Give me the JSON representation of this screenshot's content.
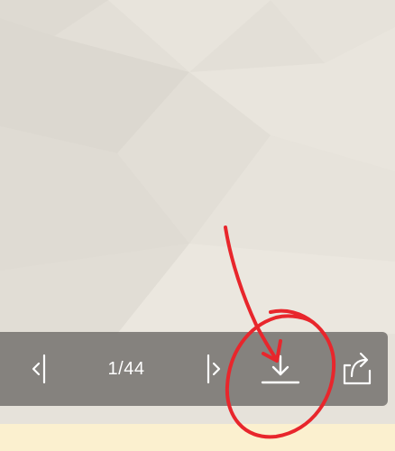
{
  "viewer": {
    "page_counter": "1/44",
    "first_page_icon": "first-page-icon",
    "last_page_icon": "last-page-icon",
    "download_icon": "download-icon",
    "share_icon": "share-icon"
  },
  "colors": {
    "background": "#e4e0d8",
    "toolbar": "#696764",
    "toolbar_icon": "#ffffff",
    "annotation": "#e8262c",
    "bottom_strip": "#fbf0cf"
  }
}
